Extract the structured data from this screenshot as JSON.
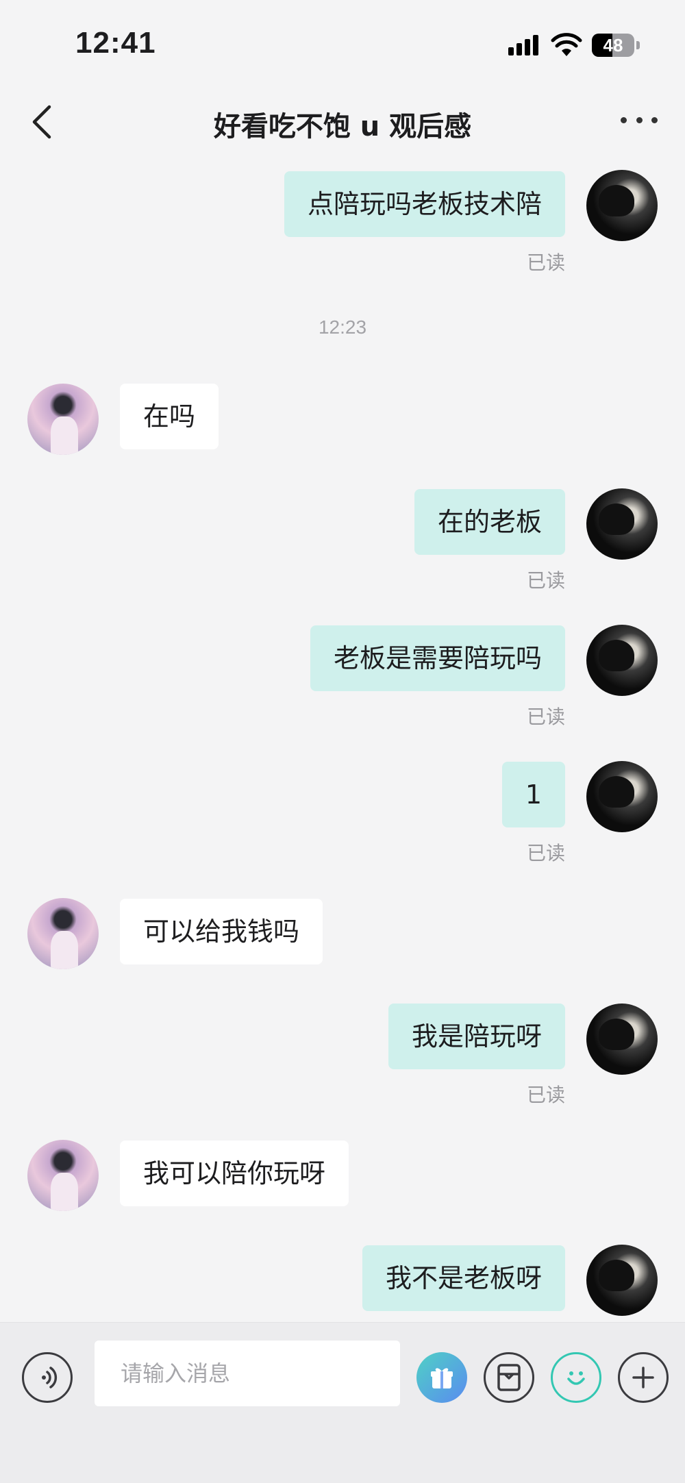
{
  "status_bar": {
    "time": "12:41",
    "battery_level": "48",
    "icons": [
      "signal-icon",
      "wifi-icon",
      "battery-icon"
    ]
  },
  "header": {
    "title": "好看吃不饱 u 观后感",
    "icons": [
      "back-icon",
      "more-icon"
    ]
  },
  "chat": {
    "timestamp": "12:23",
    "messages": [
      {
        "from": "me",
        "text": "点陪玩吗老板技术陪",
        "status": "已读"
      },
      {
        "from": "other",
        "text": "在吗"
      },
      {
        "from": "me",
        "text": "在的老板",
        "status": "已读"
      },
      {
        "from": "me",
        "text": "老板是需要陪玩吗",
        "status": "已读"
      },
      {
        "from": "me",
        "text": "1",
        "status": "已读"
      },
      {
        "from": "other",
        "text": "可以给我钱吗"
      },
      {
        "from": "me",
        "text": "我是陪玩呀",
        "status": "已读"
      },
      {
        "from": "other",
        "text": "我可以陪你玩呀"
      },
      {
        "from": "me",
        "text": "我不是老板呀"
      }
    ]
  },
  "input_bar": {
    "placeholder": "请输入消息",
    "icons": [
      "voice-icon",
      "gift-icon",
      "card-icon",
      "emoji-icon",
      "plus-icon"
    ]
  },
  "colors": {
    "background": "#f4f4f5",
    "my_bubble": "#cff0ec",
    "other_bubble": "#ffffff",
    "accent": "#33c7b2",
    "muted_text": "#9a9a9e"
  }
}
